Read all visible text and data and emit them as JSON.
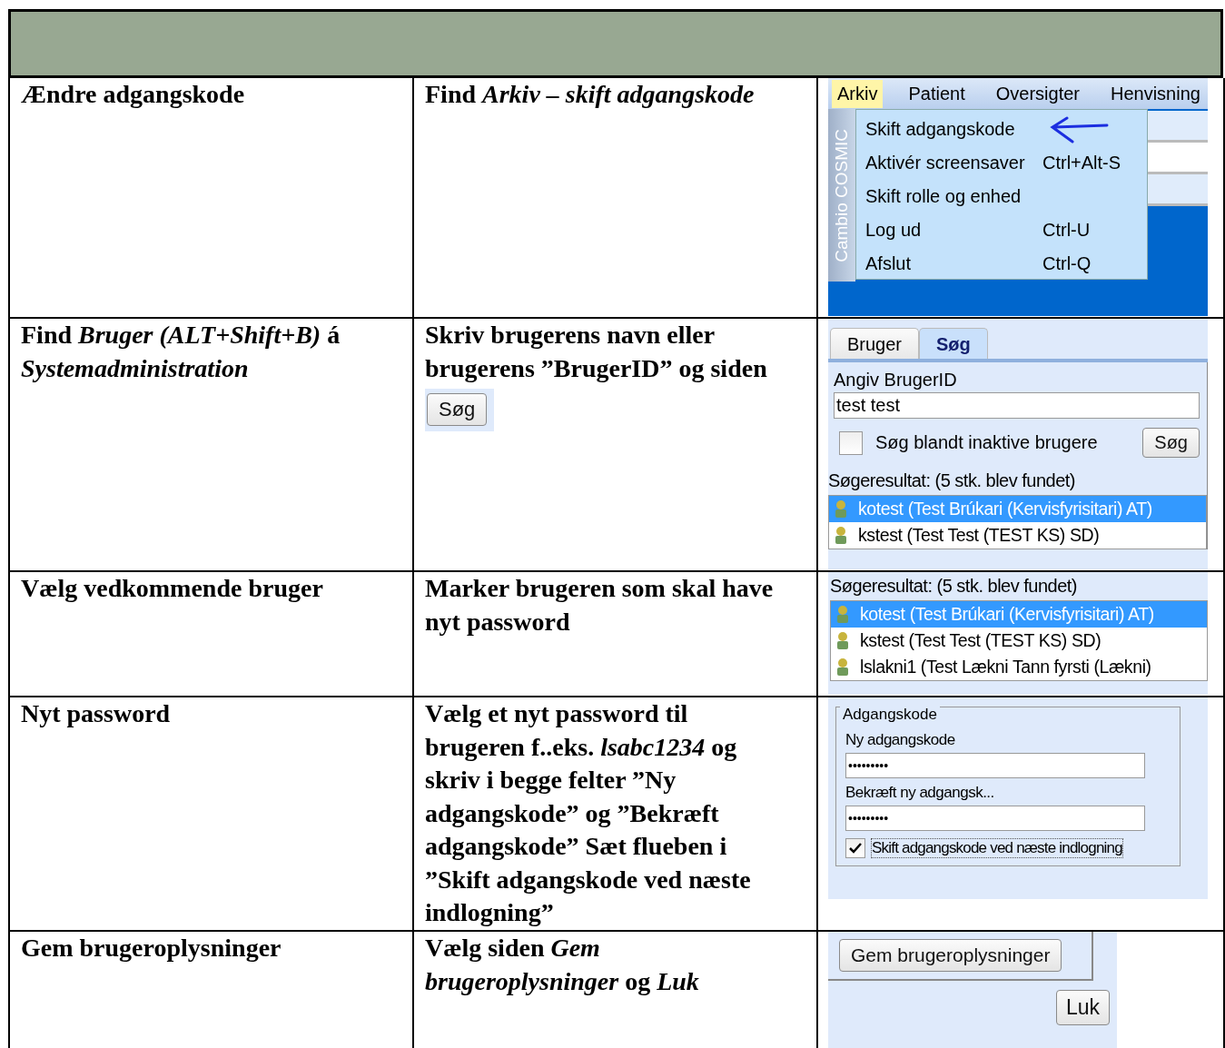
{
  "rows": [
    {
      "step": "Ændre adgangskode",
      "instruction": "Find *Arkiv – skift adgangskode*",
      "screenshot": {
        "kind": "menu",
        "menubar": [
          {
            "label": "Arkiv",
            "selected": true
          },
          {
            "label": "Patient",
            "selected": false
          },
          {
            "label": "Oversigter",
            "selected": false
          },
          {
            "label": "Henvisning",
            "selected": false
          }
        ],
        "side_label": "Cambio COSMIC",
        "menu_items": [
          {
            "label": "Skift adgangskode",
            "pointed": true
          },
          {
            "label": "Aktivér screensaver",
            "shortcut": "Ctrl+Alt-S",
            "pointed": false
          },
          {
            "label": "Skift rolle og enhed",
            "pointed": false
          },
          {
            "label": "Log ud",
            "shortcut": "Ctrl-U",
            "pointed": false
          },
          {
            "label": "Afslut",
            "shortcut": "Ctrl-Q",
            "pointed": false
          }
        ]
      }
    },
    {
      "step": "Find *Bruger (ALT+Shift+B)* á *Systemadministration*",
      "instruction": "Skriv brugerens navn eller brugerens  ”BrugerID” og siden",
      "button": "Søg",
      "screenshot": {
        "kind": "user_search",
        "tabs": [
          {
            "label": "Bruger",
            "selected": false
          },
          {
            "label": "Søg",
            "selected": true
          }
        ],
        "field_label": "Angiv BrugerID",
        "field_value": "test test",
        "checkbox": {
          "label": "Søg blandt inaktive brugere",
          "checked": false
        },
        "search_button": "Søg",
        "results_label": "Søgeresultat: (5 stk. blev fundet)",
        "results": [
          {
            "label": "kotest (Test Brúkari (Kervisfyrisitari) AT)",
            "selected": true
          },
          {
            "label": "kstest (Test Test (TEST KS) SD)",
            "selected": false
          }
        ]
      }
    },
    {
      "step": "Vælg vedkommende bruger",
      "instruction": "Marker brugeren som skal have nyt password",
      "screenshot": {
        "kind": "result_list",
        "results_label": "Søgeresultat: (5 stk. blev fundet)",
        "results": [
          {
            "label": "kotest (Test Brúkari (Kervisfyrisitari) AT)",
            "selected": true
          },
          {
            "label": "kstest (Test Test (TEST KS) SD)",
            "selected": false
          },
          {
            "label": "lslakni1 (Test Lækni Tann fyrsti (Lækni)",
            "selected": false
          }
        ]
      }
    },
    {
      "step": "Nyt password",
      "instruction": "Vælg et nyt password til brugeren f..eks. *lsabc1234* og skriv i begge felter ”Ny adgangskode” og ”Bekræft adgangskode” Sæt flueben i ”Skift adgangskode  ved næste indlogning”",
      "screenshot": {
        "kind": "password",
        "group_label": "Adgangskode",
        "fields": [
          {
            "label": "Ny adgangskode",
            "value": "•••••••••"
          },
          {
            "label": "Bekræft ny adgangsk...",
            "value": "•••••••••"
          }
        ],
        "checkbox": {
          "label": "Skift adgangskode ved næste indlogning",
          "checked": true
        }
      }
    },
    {
      "step": "Gem brugeroplysninger",
      "instruction": "Vælg siden *Gem brugeroplysninger* og *Luk*",
      "screenshot": {
        "kind": "save_buttons",
        "buttons": [
          "Gem brugeroplysninger",
          "Luk"
        ]
      }
    }
  ]
}
